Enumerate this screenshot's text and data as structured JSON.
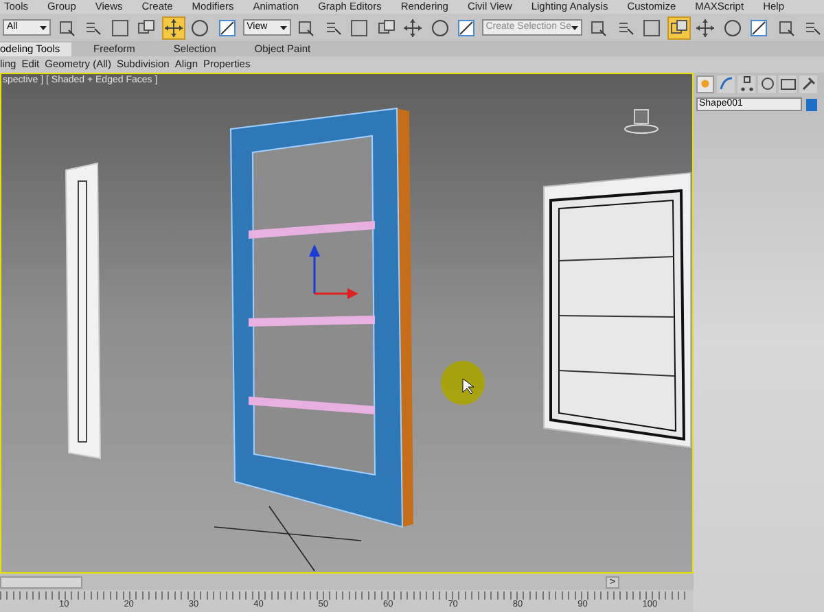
{
  "menu_bar": [
    "Tools",
    "Group",
    "Views",
    "Create",
    "Modifiers",
    "Animation",
    "Graph Editors",
    "Rendering",
    "Civil View",
    "Lighting Analysis",
    "Customize",
    "MAXScript",
    "Help"
  ],
  "toolbar": [
    {
      "kind": "dropdown",
      "value": "All"
    },
    {
      "kind": "button",
      "selected": false
    },
    {
      "kind": "button",
      "selected": false
    },
    {
      "kind": "button",
      "selected": false
    },
    {
      "kind": "button",
      "selected": false
    },
    {
      "kind": "button",
      "selected": true
    },
    {
      "kind": "button",
      "selected": false
    },
    {
      "kind": "button",
      "selected": false
    },
    {
      "kind": "dropdown",
      "value": "View"
    },
    {
      "kind": "button",
      "selected": false
    },
    {
      "kind": "button",
      "selected": false
    },
    {
      "kind": "button",
      "selected": false
    },
    {
      "kind": "button",
      "selected": false
    },
    {
      "kind": "button",
      "selected": false
    },
    {
      "kind": "button",
      "selected": false
    },
    {
      "kind": "button",
      "selected": false
    },
    {
      "kind": "dropdown",
      "value": "Create Selection Se"
    },
    {
      "kind": "button",
      "selected": false
    },
    {
      "kind": "button",
      "selected": false
    },
    {
      "kind": "button",
      "selected": false
    },
    {
      "kind": "button",
      "selected": true
    },
    {
      "kind": "button",
      "selected": false
    },
    {
      "kind": "button",
      "selected": false
    },
    {
      "kind": "button",
      "selected": false
    },
    {
      "kind": "button",
      "selected": false
    },
    {
      "kind": "button",
      "selected": false
    }
  ],
  "ribbon_tabs": [
    {
      "label": "odeling Tools",
      "selected": true
    },
    {
      "label": "Freeform",
      "selected": false
    },
    {
      "label": "Selection",
      "selected": false
    },
    {
      "label": "Object Paint",
      "selected": false
    }
  ],
  "ribbon_panels": [
    "ling",
    "Edit",
    "Geometry (All)",
    "Subdivision",
    "Align",
    "Properties"
  ],
  "viewport": {
    "label": "spective ] [ Shaded + Edged Faces ]"
  },
  "command_panel": {
    "tabs": [
      {
        "selected": true
      },
      {
        "selected": false
      },
      {
        "selected": false
      },
      {
        "selected": false
      },
      {
        "selected": false
      },
      {
        "selected": false
      }
    ],
    "object_name": "Shape001"
  },
  "time_slider": {
    "level": 0,
    "next_button": ">"
  },
  "track_bar": {
    "labels": [
      "10",
      "20",
      "30",
      "40",
      "50",
      "60",
      "70",
      "80",
      "90",
      "100"
    ]
  }
}
